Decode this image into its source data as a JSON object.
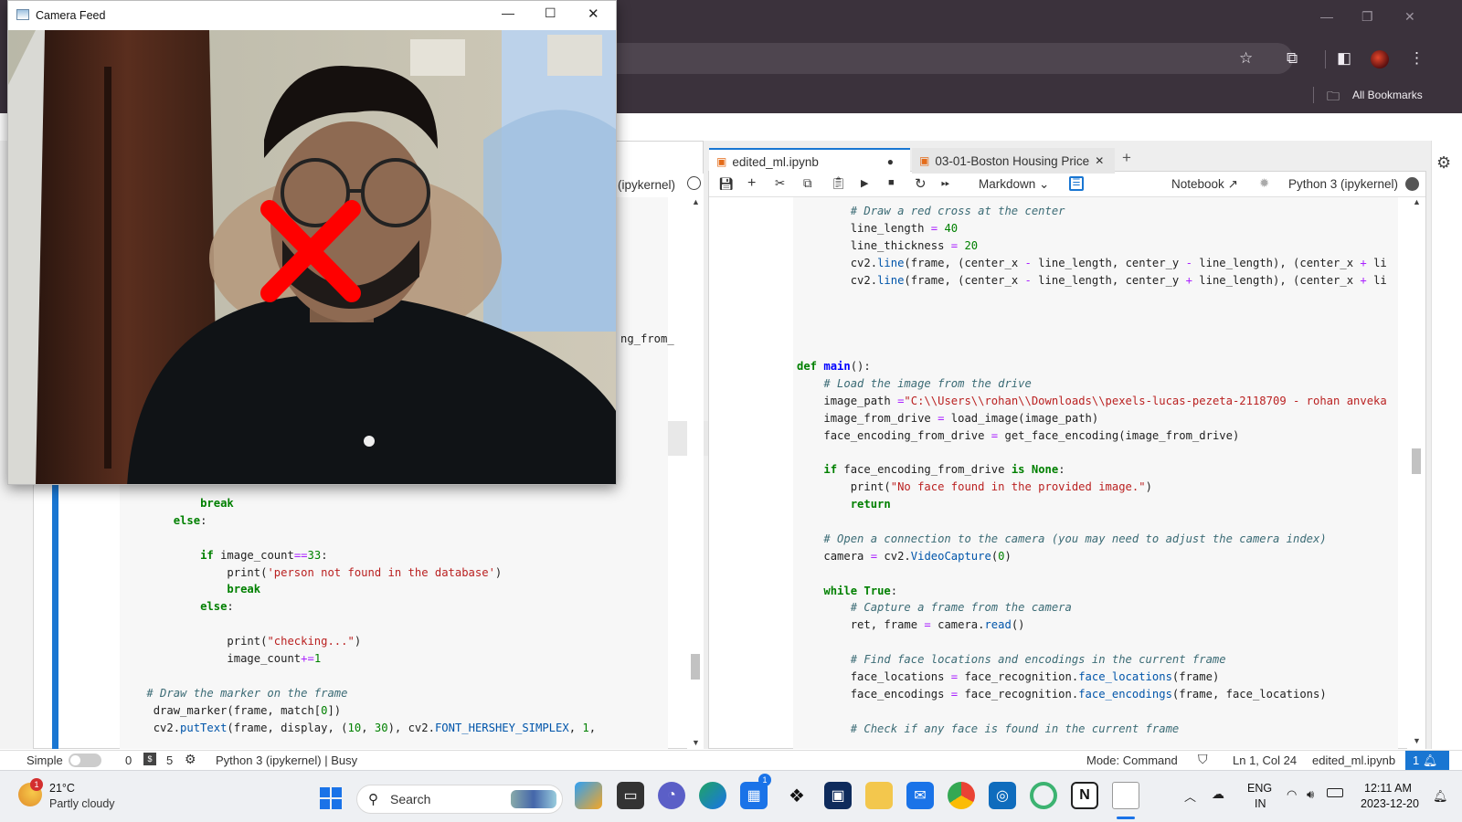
{
  "camera_window": {
    "title": "Camera Feed"
  },
  "browser": {
    "bookmarks_label": "All Bookmarks"
  },
  "notebook": {
    "left_kernel_fragment": "(ipykernel)",
    "left_code_fragment": "ng_from_",
    "left_code": [
      {
        "indent": "            ",
        "parts": [
          [
            "kw",
            "break"
          ]
        ]
      },
      {
        "indent": "        ",
        "parts": [
          [
            "kw",
            "else"
          ],
          [
            "",
            ":"
          ]
        ]
      },
      {
        "indent": "",
        "parts": [
          [
            "",
            ""
          ]
        ]
      },
      {
        "indent": "            ",
        "parts": [
          [
            "kw",
            "if"
          ],
          [
            "",
            " image_count"
          ],
          [
            "op",
            "=="
          ],
          [
            "nm",
            "33"
          ],
          [
            "",
            ":"
          ]
        ]
      },
      {
        "indent": "                ",
        "parts": [
          [
            "",
            "print("
          ],
          [
            "st",
            "'person not found in the database'"
          ],
          [
            "",
            ")"
          ]
        ]
      },
      {
        "indent": "                ",
        "parts": [
          [
            "kw",
            "break"
          ]
        ]
      },
      {
        "indent": "            ",
        "parts": [
          [
            "kw",
            "else"
          ],
          [
            "",
            ":"
          ]
        ]
      },
      {
        "indent": "",
        "parts": [
          [
            "",
            ""
          ]
        ]
      },
      {
        "indent": "                ",
        "parts": [
          [
            "",
            "print("
          ],
          [
            "st",
            "\"checking...\""
          ],
          [
            "",
            ")"
          ]
        ]
      },
      {
        "indent": "                ",
        "parts": [
          [
            "",
            "image_count"
          ],
          [
            "op",
            "+="
          ],
          [
            "nm",
            "1"
          ]
        ]
      },
      {
        "indent": "",
        "parts": [
          [
            "",
            ""
          ]
        ]
      },
      {
        "indent": "    ",
        "parts": [
          [
            "cm",
            "# Draw the marker on the frame"
          ]
        ]
      },
      {
        "indent": "     ",
        "parts": [
          [
            "",
            "draw_marker(frame, match["
          ],
          [
            "nm",
            "0"
          ],
          [
            "",
            "])"
          ]
        ]
      },
      {
        "indent": "     ",
        "parts": [
          [
            "",
            "cv2."
          ],
          [
            "fn",
            "putText"
          ],
          [
            "",
            "(frame, display, ("
          ],
          [
            "nm",
            "10"
          ],
          [
            "",
            ", "
          ],
          [
            "nm",
            "30"
          ],
          [
            "",
            "), cv2."
          ],
          [
            "fn",
            "FONT_HERSHEY_SIMPLEX"
          ],
          [
            "",
            ", "
          ],
          [
            "nm",
            "1"
          ],
          [
            "",
            ","
          ]
        ]
      }
    ],
    "tabs": [
      {
        "label": "edited_ml.ipynb",
        "dirty": "●"
      },
      {
        "label": "03-01-Boston Housing Price",
        "close": "✕"
      }
    ],
    "new_tab": "+",
    "toolbar": {
      "cell_type": "Markdown",
      "notebook_label": "Notebook",
      "kernel_label": "Python 3 (ipykernel)"
    },
    "right_code": [
      {
        "indent": "        ",
        "parts": [
          [
            "cm",
            "# Draw a red cross at the center"
          ]
        ]
      },
      {
        "indent": "        ",
        "parts": [
          [
            "",
            "line_length "
          ],
          [
            "op",
            "="
          ],
          [
            "nm",
            " 40"
          ]
        ]
      },
      {
        "indent": "        ",
        "parts": [
          [
            "",
            "line_thickness "
          ],
          [
            "op",
            "="
          ],
          [
            "nm",
            " 20"
          ]
        ]
      },
      {
        "indent": "        ",
        "parts": [
          [
            "",
            "cv2."
          ],
          [
            "fn",
            "line"
          ],
          [
            "",
            "(frame, (center_x "
          ],
          [
            "op",
            "-"
          ],
          [
            "",
            " line_length, center_y "
          ],
          [
            "op",
            "-"
          ],
          [
            "",
            " line_length), (center_x "
          ],
          [
            "op",
            "+"
          ],
          [
            "",
            " li"
          ]
        ]
      },
      {
        "indent": "        ",
        "parts": [
          [
            "",
            "cv2."
          ],
          [
            "fn",
            "line"
          ],
          [
            "",
            "(frame, (center_x "
          ],
          [
            "op",
            "-"
          ],
          [
            "",
            " line_length, center_y "
          ],
          [
            "op",
            "+"
          ],
          [
            "",
            " line_length), (center_x "
          ],
          [
            "op",
            "+"
          ],
          [
            "",
            " li"
          ]
        ]
      },
      {
        "indent": "",
        "parts": [
          [
            "",
            ""
          ]
        ]
      },
      {
        "indent": "",
        "parts": [
          [
            "",
            ""
          ]
        ]
      },
      {
        "indent": "",
        "parts": [
          [
            "",
            ""
          ]
        ]
      },
      {
        "indent": "",
        "parts": [
          [
            "",
            ""
          ]
        ]
      },
      {
        "indent": "",
        "parts": [
          [
            "kw",
            "def"
          ],
          [
            "",
            " "
          ],
          [
            "kd",
            "main"
          ],
          [
            "",
            "():"
          ]
        ]
      },
      {
        "indent": "    ",
        "parts": [
          [
            "cm",
            "# Load the image from the drive"
          ]
        ]
      },
      {
        "indent": "    ",
        "parts": [
          [
            "",
            "image_path "
          ],
          [
            "op",
            "="
          ],
          [
            "st",
            "\"C:\\\\Users\\\\rohan\\\\Downloads\\\\pexels-lucas-pezeta-2118709 - rohan anveka"
          ]
        ]
      },
      {
        "indent": "    ",
        "parts": [
          [
            "",
            "image_from_drive "
          ],
          [
            "op",
            "="
          ],
          [
            "",
            " load_image(image_path)"
          ]
        ]
      },
      {
        "indent": "    ",
        "parts": [
          [
            "",
            "face_encoding_from_drive "
          ],
          [
            "op",
            "="
          ],
          [
            "",
            " get_face_encoding(image_from_drive)"
          ]
        ]
      },
      {
        "indent": "",
        "parts": [
          [
            "",
            ""
          ]
        ]
      },
      {
        "indent": "    ",
        "parts": [
          [
            "kw",
            "if"
          ],
          [
            "",
            " face_encoding_from_drive "
          ],
          [
            "kw",
            "is"
          ],
          [
            "",
            " "
          ],
          [
            "kw",
            "None"
          ],
          [
            "",
            ":"
          ]
        ]
      },
      {
        "indent": "        ",
        "parts": [
          [
            "",
            "print("
          ],
          [
            "st",
            "\"No face found in the provided image.\""
          ],
          [
            "",
            ")"
          ]
        ]
      },
      {
        "indent": "        ",
        "parts": [
          [
            "kw",
            "return"
          ]
        ]
      },
      {
        "indent": "",
        "parts": [
          [
            "",
            ""
          ]
        ]
      },
      {
        "indent": "    ",
        "parts": [
          [
            "cm",
            "# Open a connection to the camera (you may need to adjust the camera index)"
          ]
        ]
      },
      {
        "indent": "    ",
        "parts": [
          [
            "",
            "camera "
          ],
          [
            "op",
            "="
          ],
          [
            "",
            " cv2."
          ],
          [
            "fn",
            "VideoCapture"
          ],
          [
            "",
            "("
          ],
          [
            "nm",
            "0"
          ],
          [
            "",
            ")"
          ]
        ]
      },
      {
        "indent": "",
        "parts": [
          [
            "",
            ""
          ]
        ]
      },
      {
        "indent": "    ",
        "parts": [
          [
            "kw",
            "while"
          ],
          [
            "",
            " "
          ],
          [
            "kw",
            "True"
          ],
          [
            "",
            ":"
          ]
        ]
      },
      {
        "indent": "        ",
        "parts": [
          [
            "cm",
            "# Capture a frame from the camera"
          ]
        ]
      },
      {
        "indent": "        ",
        "parts": [
          [
            "",
            "ret, frame "
          ],
          [
            "op",
            "="
          ],
          [
            "",
            " camera."
          ],
          [
            "fn",
            "read"
          ],
          [
            "",
            "()"
          ]
        ]
      },
      {
        "indent": "",
        "parts": [
          [
            "",
            ""
          ]
        ]
      },
      {
        "indent": "        ",
        "parts": [
          [
            "cm",
            "# Find face locations and encodings in the current frame"
          ]
        ]
      },
      {
        "indent": "        ",
        "parts": [
          [
            "",
            "face_locations "
          ],
          [
            "op",
            "="
          ],
          [
            "",
            " face_recognition."
          ],
          [
            "fn",
            "face_locations"
          ],
          [
            "",
            "(frame)"
          ]
        ]
      },
      {
        "indent": "        ",
        "parts": [
          [
            "",
            "face_encodings "
          ],
          [
            "op",
            "="
          ],
          [
            "",
            " face_recognition."
          ],
          [
            "fn",
            "face_encodings"
          ],
          [
            "",
            "(frame, face_locations)"
          ]
        ]
      },
      {
        "indent": "",
        "parts": [
          [
            "",
            ""
          ]
        ]
      },
      {
        "indent": "        ",
        "parts": [
          [
            "cm",
            "# Check if any face is found in the current frame"
          ]
        ]
      }
    ]
  },
  "statusbar": {
    "mode_label": "Simple",
    "count_a": "0",
    "count_b": "5",
    "kernel_status": "Python 3 (ipykernel) | Busy",
    "mode": "Mode: Command",
    "cursor": "Ln 1, Col 24",
    "filename": "edited_ml.ipynb",
    "notifications": "1"
  },
  "taskbar": {
    "weather_badge": "1",
    "temperature": "21°C",
    "weather": "Partly cloudy",
    "search_placeholder": "Search",
    "lang_line1": "ENG",
    "lang_line2": "IN",
    "time": "12:11 AM",
    "date": "2023-12-20",
    "store_badge": "1"
  },
  "colors": {
    "accent": "#1976d2",
    "marker_red": "#ff0000",
    "titlebar_dark": "#3b323c"
  }
}
